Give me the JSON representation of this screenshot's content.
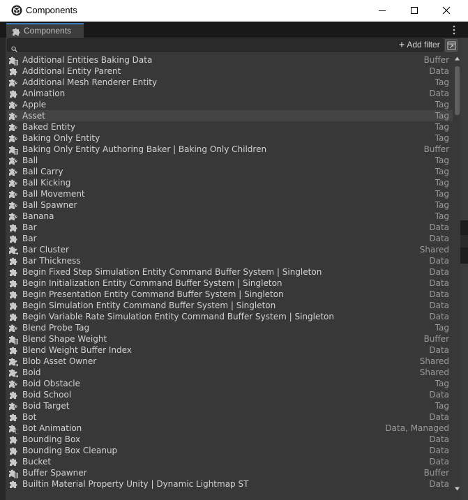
{
  "window": {
    "title": "Components",
    "icon": "unity-logo-icon",
    "controls": [
      "minimize-icon",
      "maximize-icon",
      "close-icon"
    ]
  },
  "tab": {
    "label": "Components",
    "icon": "component-puzzle-icon"
  },
  "toolbar": {
    "search_value": "",
    "search_icon": "search-icon",
    "add_filter_label": "Add filter",
    "add_filter_icon": "plus-icon",
    "dock_icon": "dock-window-icon",
    "menu_icon": "kebab-menu-icon"
  },
  "colors": {
    "background": "#383838",
    "text": "#d2d2d2",
    "type_text": "#9a9a9a",
    "selection": "#444444",
    "tab_accent": "#3a79bb"
  },
  "components": {
    "selected_index": 5,
    "rows": [
      {
        "name": "Additional Entities Baking Data",
        "type": "Buffer",
        "icon": "buffer-icon"
      },
      {
        "name": "Additional Entity Parent",
        "type": "Data",
        "icon": "data-icon"
      },
      {
        "name": "Additional Mesh Renderer Entity",
        "type": "Tag",
        "icon": "tag-icon"
      },
      {
        "name": "Animation",
        "type": "Data",
        "icon": "data-icon"
      },
      {
        "name": "Apple",
        "type": "Tag",
        "icon": "tag-icon"
      },
      {
        "name": "Asset",
        "type": "Tag",
        "icon": "tag-icon"
      },
      {
        "name": "Baked Entity",
        "type": "Tag",
        "icon": "tag-icon"
      },
      {
        "name": "Baking Only Entity",
        "type": "Tag",
        "icon": "tag-icon"
      },
      {
        "name": "Baking Only Entity Authoring Baker | Baking Only Children",
        "type": "Buffer",
        "icon": "buffer-icon"
      },
      {
        "name": "Ball",
        "type": "Tag",
        "icon": "tag-icon"
      },
      {
        "name": "Ball Carry",
        "type": "Tag",
        "icon": "tag-icon"
      },
      {
        "name": "Ball Kicking",
        "type": "Tag",
        "icon": "tag-icon"
      },
      {
        "name": "Ball Movement",
        "type": "Tag",
        "icon": "tag-icon"
      },
      {
        "name": "Ball Spawner",
        "type": "Tag",
        "icon": "tag-icon"
      },
      {
        "name": "Banana",
        "type": "Tag",
        "icon": "tag-icon"
      },
      {
        "name": "Bar",
        "type": "Data",
        "icon": "data-icon"
      },
      {
        "name": "Bar",
        "type": "Data",
        "icon": "data-icon"
      },
      {
        "name": "Bar Cluster",
        "type": "Shared",
        "icon": "shared-icon"
      },
      {
        "name": "Bar Thickness",
        "type": "Data",
        "icon": "data-icon"
      },
      {
        "name": "Begin Fixed Step Simulation Entity Command Buffer System | Singleton",
        "type": "Data",
        "icon": "data-icon"
      },
      {
        "name": "Begin Initialization Entity Command Buffer System | Singleton",
        "type": "Data",
        "icon": "data-icon"
      },
      {
        "name": "Begin Presentation Entity Command Buffer System | Singleton",
        "type": "Data",
        "icon": "data-icon"
      },
      {
        "name": "Begin Simulation Entity Command Buffer System | Singleton",
        "type": "Data",
        "icon": "data-icon"
      },
      {
        "name": "Begin Variable Rate Simulation Entity Command Buffer System | Singleton",
        "type": "Data",
        "icon": "data-icon"
      },
      {
        "name": "Blend Probe Tag",
        "type": "Tag",
        "icon": "tag-icon"
      },
      {
        "name": "Blend Shape Weight",
        "type": "Buffer",
        "icon": "buffer-icon"
      },
      {
        "name": "Blend Weight Buffer Index",
        "type": "Data",
        "icon": "data-icon"
      },
      {
        "name": "Blob Asset Owner",
        "type": "Shared",
        "icon": "shared-icon"
      },
      {
        "name": "Boid",
        "type": "Shared",
        "icon": "shared-icon"
      },
      {
        "name": "Boid Obstacle",
        "type": "Tag",
        "icon": "tag-icon"
      },
      {
        "name": "Boid School",
        "type": "Data",
        "icon": "data-icon"
      },
      {
        "name": "Boid Target",
        "type": "Tag",
        "icon": "tag-icon"
      },
      {
        "name": "Bot",
        "type": "Data",
        "icon": "data-icon"
      },
      {
        "name": "Bot Animation",
        "type": "Data, Managed",
        "icon": "managed-icon"
      },
      {
        "name": "Bounding Box",
        "type": "Data",
        "icon": "data-icon"
      },
      {
        "name": "Bounding Box Cleanup",
        "type": "Data",
        "icon": "data-icon"
      },
      {
        "name": "Bucket",
        "type": "Data",
        "icon": "data-icon"
      },
      {
        "name": "Buffer Spawner",
        "type": "Buffer",
        "icon": "buffer-icon"
      },
      {
        "name": "Builtin Material Property Unity | Dynamic Lightmap ST",
        "type": "Data",
        "icon": "data-icon"
      }
    ]
  }
}
